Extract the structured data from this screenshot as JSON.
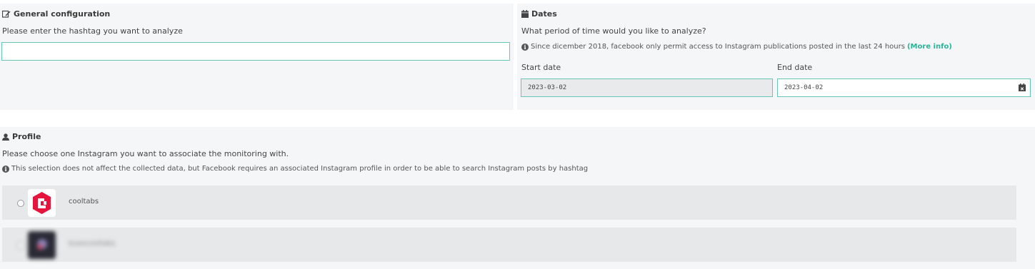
{
  "general": {
    "title": "General configuration",
    "hashtag_prompt": "Please enter the hashtag you want to analyze",
    "hashtag_value": ""
  },
  "dates": {
    "title": "Dates",
    "question": "What period of time would you like to analyze?",
    "notice": "Since dicember 2018, facebook only permit access to Instagram publications posted in the last 24 hours",
    "more_info": "(More info)",
    "start_label": "Start date",
    "end_label": "End date",
    "start_value": "2023-03-02",
    "end_value": "2023-04-02"
  },
  "profile": {
    "title": "Profile",
    "prompt": "Please choose one Instagram you want to associate the monitoring with.",
    "notice": "This selection does not affect the collected data, but Facebook requires an associated Instagram profile in order to be able to search Instagram posts by hashtag",
    "accounts": [
      {
        "name": "cooltabs",
        "brand_color": "#e5153b"
      },
      {
        "name": "kuescooltabs",
        "brand_color": "#2a2a35"
      }
    ]
  },
  "colors": {
    "accent": "#2db39b",
    "input_border": "#66c7b8",
    "panel_bg": "#f5f6f7"
  }
}
